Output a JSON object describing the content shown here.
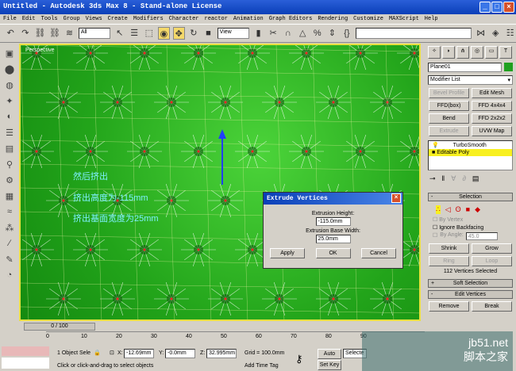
{
  "window": {
    "title": "Untitled - Autodesk 3ds Max 8  - Stand-alone License"
  },
  "menu": [
    "File",
    "Edit",
    "Tools",
    "Group",
    "Views",
    "Create",
    "Modifiers",
    "Character",
    "reactor",
    "Animation",
    "Graph Editors",
    "Rendering",
    "Customize",
    "MAXScript",
    "Help"
  ],
  "toolbar": {
    "selection_filter": "All",
    "ref_coord": "View"
  },
  "viewport": {
    "label": "Perspective",
    "annotations": [
      "然后挤出",
      "挤出高度为-115mm",
      "挤出基面宽度为25mm"
    ]
  },
  "command_panel": {
    "object_name": "Plane01",
    "object_color": "#1fa01f",
    "modifier_list": "Modifier List",
    "modifier_buttons": [
      {
        "label": "Bevel Profile",
        "enabled": false
      },
      {
        "label": "Edit Mesh",
        "enabled": true
      },
      {
        "label": "FFD(box)",
        "enabled": true
      },
      {
        "label": "FFD 4x4x4",
        "enabled": true
      },
      {
        "label": "Bend",
        "enabled": true
      },
      {
        "label": "FFD 2x2x2",
        "enabled": true
      },
      {
        "label": "Extrude",
        "enabled": false
      },
      {
        "label": "UVW Map",
        "enabled": true
      }
    ],
    "stack": [
      "TurboSmooth",
      "Editable Poly"
    ],
    "selection_rollout": "Selection",
    "by_vertex": "By Vertex",
    "ignore_backfacing": "Ignore Backfacing",
    "by_angle": "By Angle:",
    "angle_value": "45.0",
    "shrink": "Shrink",
    "grow": "Grow",
    "ring": "Ring",
    "loop": "Loop",
    "selected_count": "112 Vertices Selected",
    "soft_selection": "Soft Selection",
    "edit_vertices": "Edit Vertices",
    "remove": "Remove",
    "break": "Break"
  },
  "dialog": {
    "title": "Extrude Vertices",
    "height_label": "Extrusion Height:",
    "height_value": "-115.0mm",
    "width_label": "Extrusion Base Width:",
    "width_value": "25.0mm",
    "apply": "Apply",
    "ok": "OK",
    "cancel": "Cancel"
  },
  "timeline": {
    "frame": "0 / 100",
    "ticks": [
      "0",
      "10",
      "20",
      "30",
      "40",
      "50",
      "60",
      "70",
      "80",
      "90"
    ]
  },
  "status": {
    "selection": "1 Object Sele",
    "x": "-12.69mm",
    "y": "-0.0mm",
    "z": "32.995mm",
    "grid": "Grid = 100.0mm",
    "prompt": "Click or click-and-drag to select objects",
    "add_time_tag": "Add Time Tag",
    "auto_key": "Auto Key",
    "set_key": "Set Key",
    "key_filter": "Selecte"
  },
  "watermark": {
    "site": "jb51.net",
    "name": "脚本之家"
  }
}
